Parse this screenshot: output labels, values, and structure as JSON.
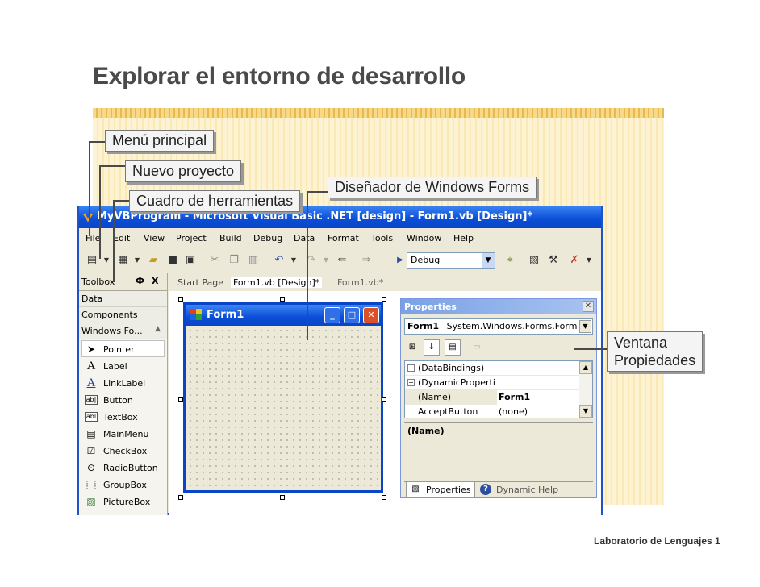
{
  "slide": {
    "title": "Explorar el entorno de desarrollo",
    "footer": "Laboratorio de Lenguajes 1"
  },
  "callouts": {
    "menu": "Menú principal",
    "new_project": "Nuevo proyecto",
    "toolbox": "Cuadro de herramientas",
    "designer": "Diseñador de Windows Forms",
    "props_line1": "Ventana",
    "props_line2": "Propiedades"
  },
  "ide": {
    "title": "MyVBProgram - Microsoft Visual Basic .NET [design] - Form1.vb [Design]*",
    "menu": [
      "File",
      "Edit",
      "View",
      "Project",
      "Build",
      "Debug",
      "Data",
      "Format",
      "Tools",
      "Window",
      "Help"
    ],
    "config": "Debug",
    "tabs": [
      "Start Page",
      "Form1.vb [Design]*",
      "Form1.vb*"
    ]
  },
  "toolbox": {
    "title": "Toolbox",
    "pin": "Ф",
    "close": "X",
    "categories": [
      "Data",
      "Components",
      "Windows Fo..."
    ],
    "items": [
      "Pointer",
      "Label",
      "LinkLabel",
      "Button",
      "TextBox",
      "MainMenu",
      "CheckBox",
      "RadioButton",
      "GroupBox",
      "PictureBox"
    ]
  },
  "form": {
    "title": "Form1"
  },
  "properties": {
    "title": "Properties",
    "object": "Form1",
    "object_type": "System.Windows.Forms.Form",
    "rows": [
      {
        "name": "(DataBindings)",
        "value": ""
      },
      {
        "name": "(DynamicPropertie",
        "value": ""
      },
      {
        "name": "(Name)",
        "value": "Form1"
      },
      {
        "name": "AcceptButton",
        "value": "(none)"
      }
    ],
    "description": "(Name)",
    "tabs": [
      "Properties",
      "Dynamic Help"
    ]
  }
}
